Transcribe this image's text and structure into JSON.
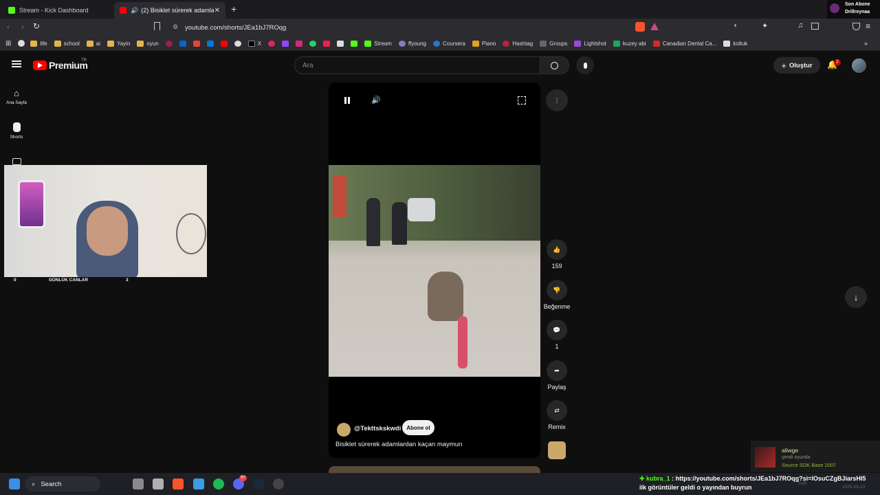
{
  "browser": {
    "tabs": [
      {
        "title": "Stream - Kick Dashboard",
        "favicon_color": "#53fc18"
      },
      {
        "title": "(2) Bisiklet sürerek adamlardan",
        "favicon_color": "#ff0000"
      }
    ],
    "new_tab_label": "+",
    "address": "youtube.com/shorts/JEa1bJ7ROqg",
    "bookmarks": [
      "life",
      "school",
      "ai",
      "Yayin",
      "oyun",
      "X",
      "Stream",
      "ffyoung",
      "Coursera",
      "Piano",
      "Hashtag",
      "Groups",
      "Lightshot",
      "kuzey abi",
      "Canadian Dental Ca...",
      "koltuk"
    ]
  },
  "follower_widget": {
    "line1": "Son Abone",
    "line2": "Drillreynaa"
  },
  "youtube": {
    "logo_text": "Premium",
    "logo_sup": "TR",
    "search_placeholder": "Ara",
    "create_label": "Oluştur",
    "notification_count": "2",
    "sidebar": [
      {
        "label": "Ana Sayfa",
        "icon": "home-icon"
      },
      {
        "label": "Shorts",
        "icon": "shorts-icon"
      }
    ],
    "short": {
      "channel": "@Tekttskskwdi",
      "subscribe_label": "Abone ol",
      "title": "Bisiklet sürerek adamlardan kaçan maymun"
    },
    "actions": {
      "likes": "159",
      "dislike_label": "Beğenme",
      "comments": "1",
      "share_label": "Paylaş",
      "remix_label": "Remix"
    }
  },
  "webcam": {
    "left_count": "0",
    "label": "GÜNLÜK CANLAR",
    "right_count": "3"
  },
  "notification": {
    "user": "aliwge",
    "status": "şimdi oyunda",
    "game": "Source SDK Base 2007"
  },
  "chat": {
    "user": "kubra_1",
    "message": ": https://youtube.com/shorts/JEa1bJ7ROqg?si=lOsuCZgBJiarsHI5",
    "message2": "ilk görüntüler geldi o yayından buyrun"
  },
  "taskbar": {
    "search_label": "Search",
    "tray_lang": "TUR",
    "date": "2025-09-13",
    "discord_badge": "9+"
  },
  "colors": {
    "accent_red": "#ff0000",
    "kick_green": "#53fc18",
    "chat_green": "#53fc18"
  }
}
